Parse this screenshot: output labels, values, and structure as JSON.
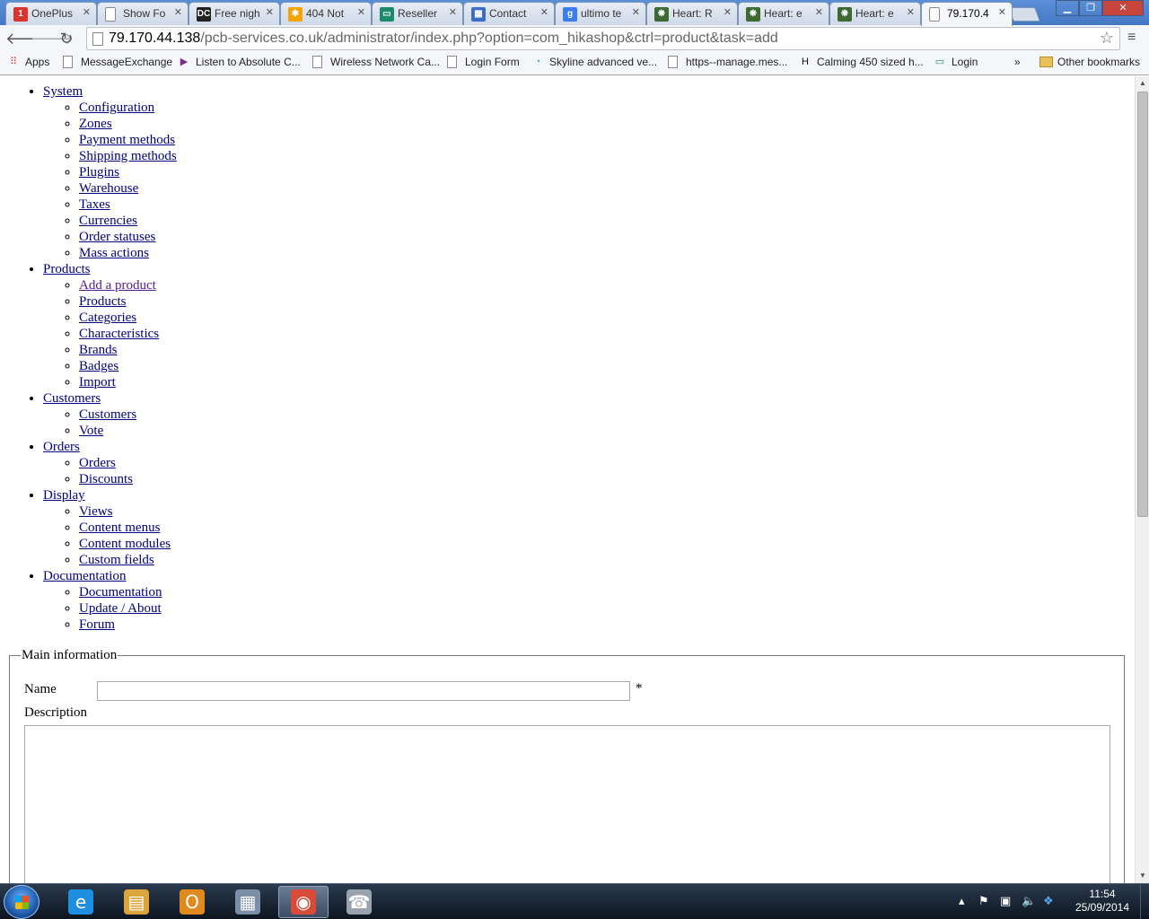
{
  "tabs": [
    {
      "title": "OnePlus",
      "icon": "oneplus-icon",
      "color": "#d9342b",
      "glyph": "1"
    },
    {
      "title": "Show Fo",
      "icon": "page-icon",
      "color": "#ffffff",
      "glyph": ""
    },
    {
      "title": "Free nigh",
      "icon": "dc-icon",
      "color": "#222222",
      "glyph": "DC"
    },
    {
      "title": "404 Not",
      "icon": "joomla-icon",
      "color": "#f4a300",
      "glyph": "✱"
    },
    {
      "title": "Reseller",
      "icon": "reseller-icon",
      "color": "#1c8a6a",
      "glyph": "▭"
    },
    {
      "title": "Contact",
      "icon": "grid-icon",
      "color": "#3a6ec4",
      "glyph": "▦"
    },
    {
      "title": "ultimo te",
      "icon": "google-icon",
      "color": "#3b7ded",
      "glyph": "g"
    },
    {
      "title": "Heart: R",
      "icon": "heart-icon",
      "color": "#3c6a32",
      "glyph": "❋"
    },
    {
      "title": "Heart: e",
      "icon": "heart-icon",
      "color": "#3c6a32",
      "glyph": "❋"
    },
    {
      "title": "Heart: e",
      "icon": "heart-icon",
      "color": "#3c6a32",
      "glyph": "❋"
    },
    {
      "title": "79.170.4",
      "icon": "page-icon",
      "color": "#ffffff",
      "glyph": "",
      "active": true
    }
  ],
  "address": {
    "host": "79.170.44.138",
    "path": "/pcb-services.co.uk/administrator/index.php?option=com_hikashop&ctrl=product&task=add"
  },
  "bookmarks": [
    {
      "label": "Apps",
      "icon": "apps-icon"
    },
    {
      "label": "MessageExchange",
      "icon": "page-icon"
    },
    {
      "label": "Listen to Absolute C...",
      "icon": "absolute-radio-icon"
    },
    {
      "label": "Wireless Network Ca...",
      "icon": "page-icon"
    },
    {
      "label": "Login Form",
      "icon": "page-icon"
    },
    {
      "label": "Skyline advanced ve...",
      "icon": "skyline-icon"
    },
    {
      "label": "https--manage.mes...",
      "icon": "page-icon"
    },
    {
      "label": "Calming 450 sized h...",
      "icon": "h-icon"
    },
    {
      "label": "Login",
      "icon": "login-icon"
    }
  ],
  "bookmarks_overflow": "»",
  "other_bookmarks": "Other bookmarks",
  "menu": [
    {
      "label": " System",
      "children": [
        " Configuration",
        " Zones",
        " Payment methods",
        " Shipping methods",
        " Plugins",
        " Warehouse",
        " Taxes",
        " Currencies",
        " Order statuses",
        " Mass actions"
      ]
    },
    {
      "label": " Products",
      "children": [
        " Add a product",
        " Products",
        " Categories",
        " Characteristics",
        " Brands",
        " Badges",
        " Import"
      ]
    },
    {
      "label": " Customers",
      "children": [
        " Customers",
        " Vote"
      ]
    },
    {
      "label": " Orders",
      "children": [
        " Orders",
        " Discounts"
      ]
    },
    {
      "label": " Display",
      "children": [
        " Views",
        " Content menus",
        " Content modules",
        " Custom fields"
      ]
    },
    {
      "label": " Documentation",
      "children": [
        " Documentation",
        " Update / About",
        " Forum"
      ]
    }
  ],
  "form": {
    "legend": "Main information",
    "name_label": "Name",
    "name_value": "",
    "required_marker": "*",
    "description_label": "Description",
    "description_value": ""
  },
  "taskbar": {
    "apps": [
      {
        "name": "internet-explorer",
        "glyph": "e",
        "color": "#1e8fe0"
      },
      {
        "name": "file-explorer",
        "glyph": "▤",
        "color": "#d9a53c"
      },
      {
        "name": "outlook",
        "glyph": "O",
        "color": "#e08a1e"
      },
      {
        "name": "calculator",
        "glyph": "▦",
        "color": "#7b8ea8"
      },
      {
        "name": "chrome",
        "glyph": "◉",
        "color": "#d94a38",
        "active": true
      },
      {
        "name": "phone",
        "glyph": "☎",
        "color": "#9aa3ad"
      }
    ],
    "time": "11:54",
    "date": "25/09/2014"
  }
}
